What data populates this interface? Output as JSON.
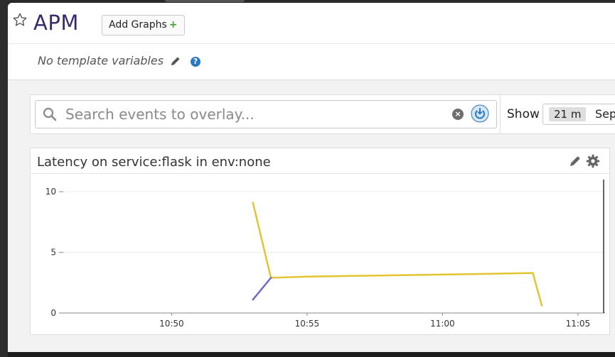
{
  "header": {
    "title": "APM",
    "add_graphs_label": "Add Graphs",
    "add_graphs_plus": "+",
    "template_vars_text": "No template variables",
    "help_glyph": "?"
  },
  "search": {
    "placeholder": "Search events to overlay...",
    "clear_glyph": "×"
  },
  "timeframe": {
    "show_label": "Show",
    "selected": "21 m",
    "next_text": "Sep"
  },
  "widget": {
    "title": "Latency on service:flask in env:none"
  },
  "colors": {
    "title": "#3b2a6b",
    "series_primary": "#e3c530",
    "series_secondary": "#7a67c2",
    "accent_blue": "#2b77c0"
  },
  "chart_data": {
    "type": "line",
    "title": "Latency on service:flask in env:none",
    "xlabel": "",
    "ylabel": "",
    "x_ticks": [
      "10:50",
      "10:55",
      "11:00",
      "11:05"
    ],
    "y_ticks": [
      0,
      5,
      10
    ],
    "xlim": [
      "10:46",
      "11:06"
    ],
    "ylim": [
      0,
      11
    ],
    "grid": true,
    "legend": "none",
    "series": [
      {
        "color": "#e3c530",
        "points": [
          {
            "x": "10:53:00",
            "y": 9.1
          },
          {
            "x": "10:53:40",
            "y": 2.9
          },
          {
            "x": "10:55:00",
            "y": 3.0
          },
          {
            "x": "10:58:00",
            "y": 3.1
          },
          {
            "x": "11:01:00",
            "y": 3.2
          },
          {
            "x": "11:03:20",
            "y": 3.3
          },
          {
            "x": "11:03:40",
            "y": 0.6
          }
        ]
      },
      {
        "color": "#7a67c2",
        "points": [
          {
            "x": "10:53:00",
            "y": 1.1
          },
          {
            "x": "10:53:40",
            "y": 2.9
          }
        ]
      }
    ],
    "now_marker": "11:06"
  }
}
